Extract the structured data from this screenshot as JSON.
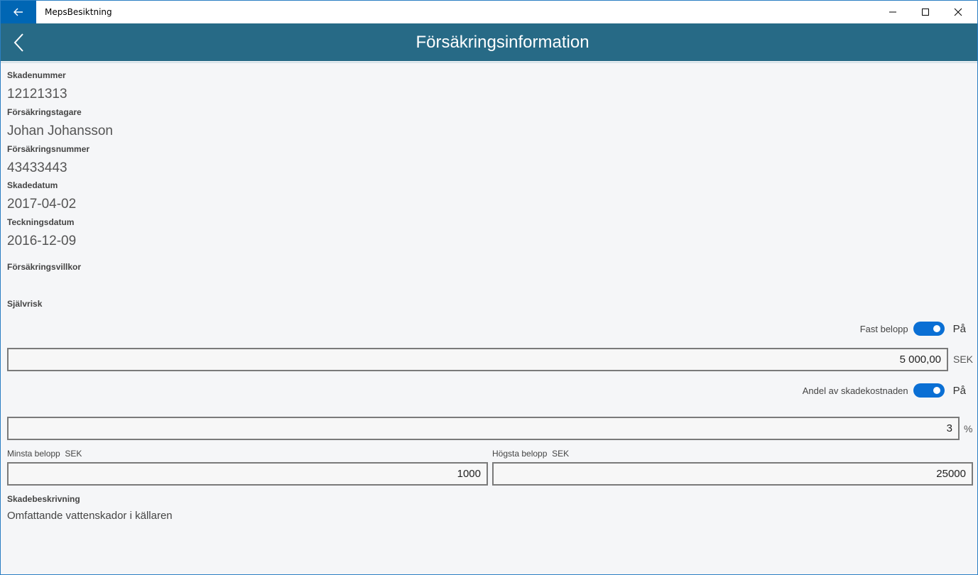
{
  "window": {
    "app_title": "MepsBesiktning"
  },
  "header": {
    "title": "Försäkringsinformation"
  },
  "fields": {
    "skadenummer": {
      "label": "Skadenummer",
      "value": "12121313"
    },
    "forsakringstagare": {
      "label": "Försäkringstagare",
      "value": "Johan Johansson"
    },
    "forsakringsnummer": {
      "label": "Försäkringsnummer",
      "value": "43433443"
    },
    "skadedatum": {
      "label": "Skadedatum",
      "value": "2017-04-02"
    },
    "teckningsdatum": {
      "label": "Teckningsdatum",
      "value": "2016-12-09"
    },
    "forsakringsvillkor": {
      "label": "Försäkringsvillkor"
    },
    "sjalvrisk": {
      "label": "Självrisk"
    }
  },
  "fast_belopp": {
    "label": "Fast belopp",
    "state": "På",
    "value": "5 000,00",
    "unit": "SEK"
  },
  "andel": {
    "label": "Andel av skadekostnaden",
    "state": "På",
    "value": "3",
    "unit": "%"
  },
  "minsta": {
    "label": "Minsta belopp",
    "unit": "SEK",
    "value": "1000"
  },
  "hogsta": {
    "label": "Högsta belopp",
    "unit": "SEK",
    "value": "25000"
  },
  "skadebeskrivning": {
    "label": "Skadebeskrivning",
    "value": "Omfattande vattenskador i källaren"
  },
  "colors": {
    "header_bg": "#276a86",
    "titlebar_back_bg": "#0066b4",
    "toggle_on": "#0a6fd4"
  }
}
